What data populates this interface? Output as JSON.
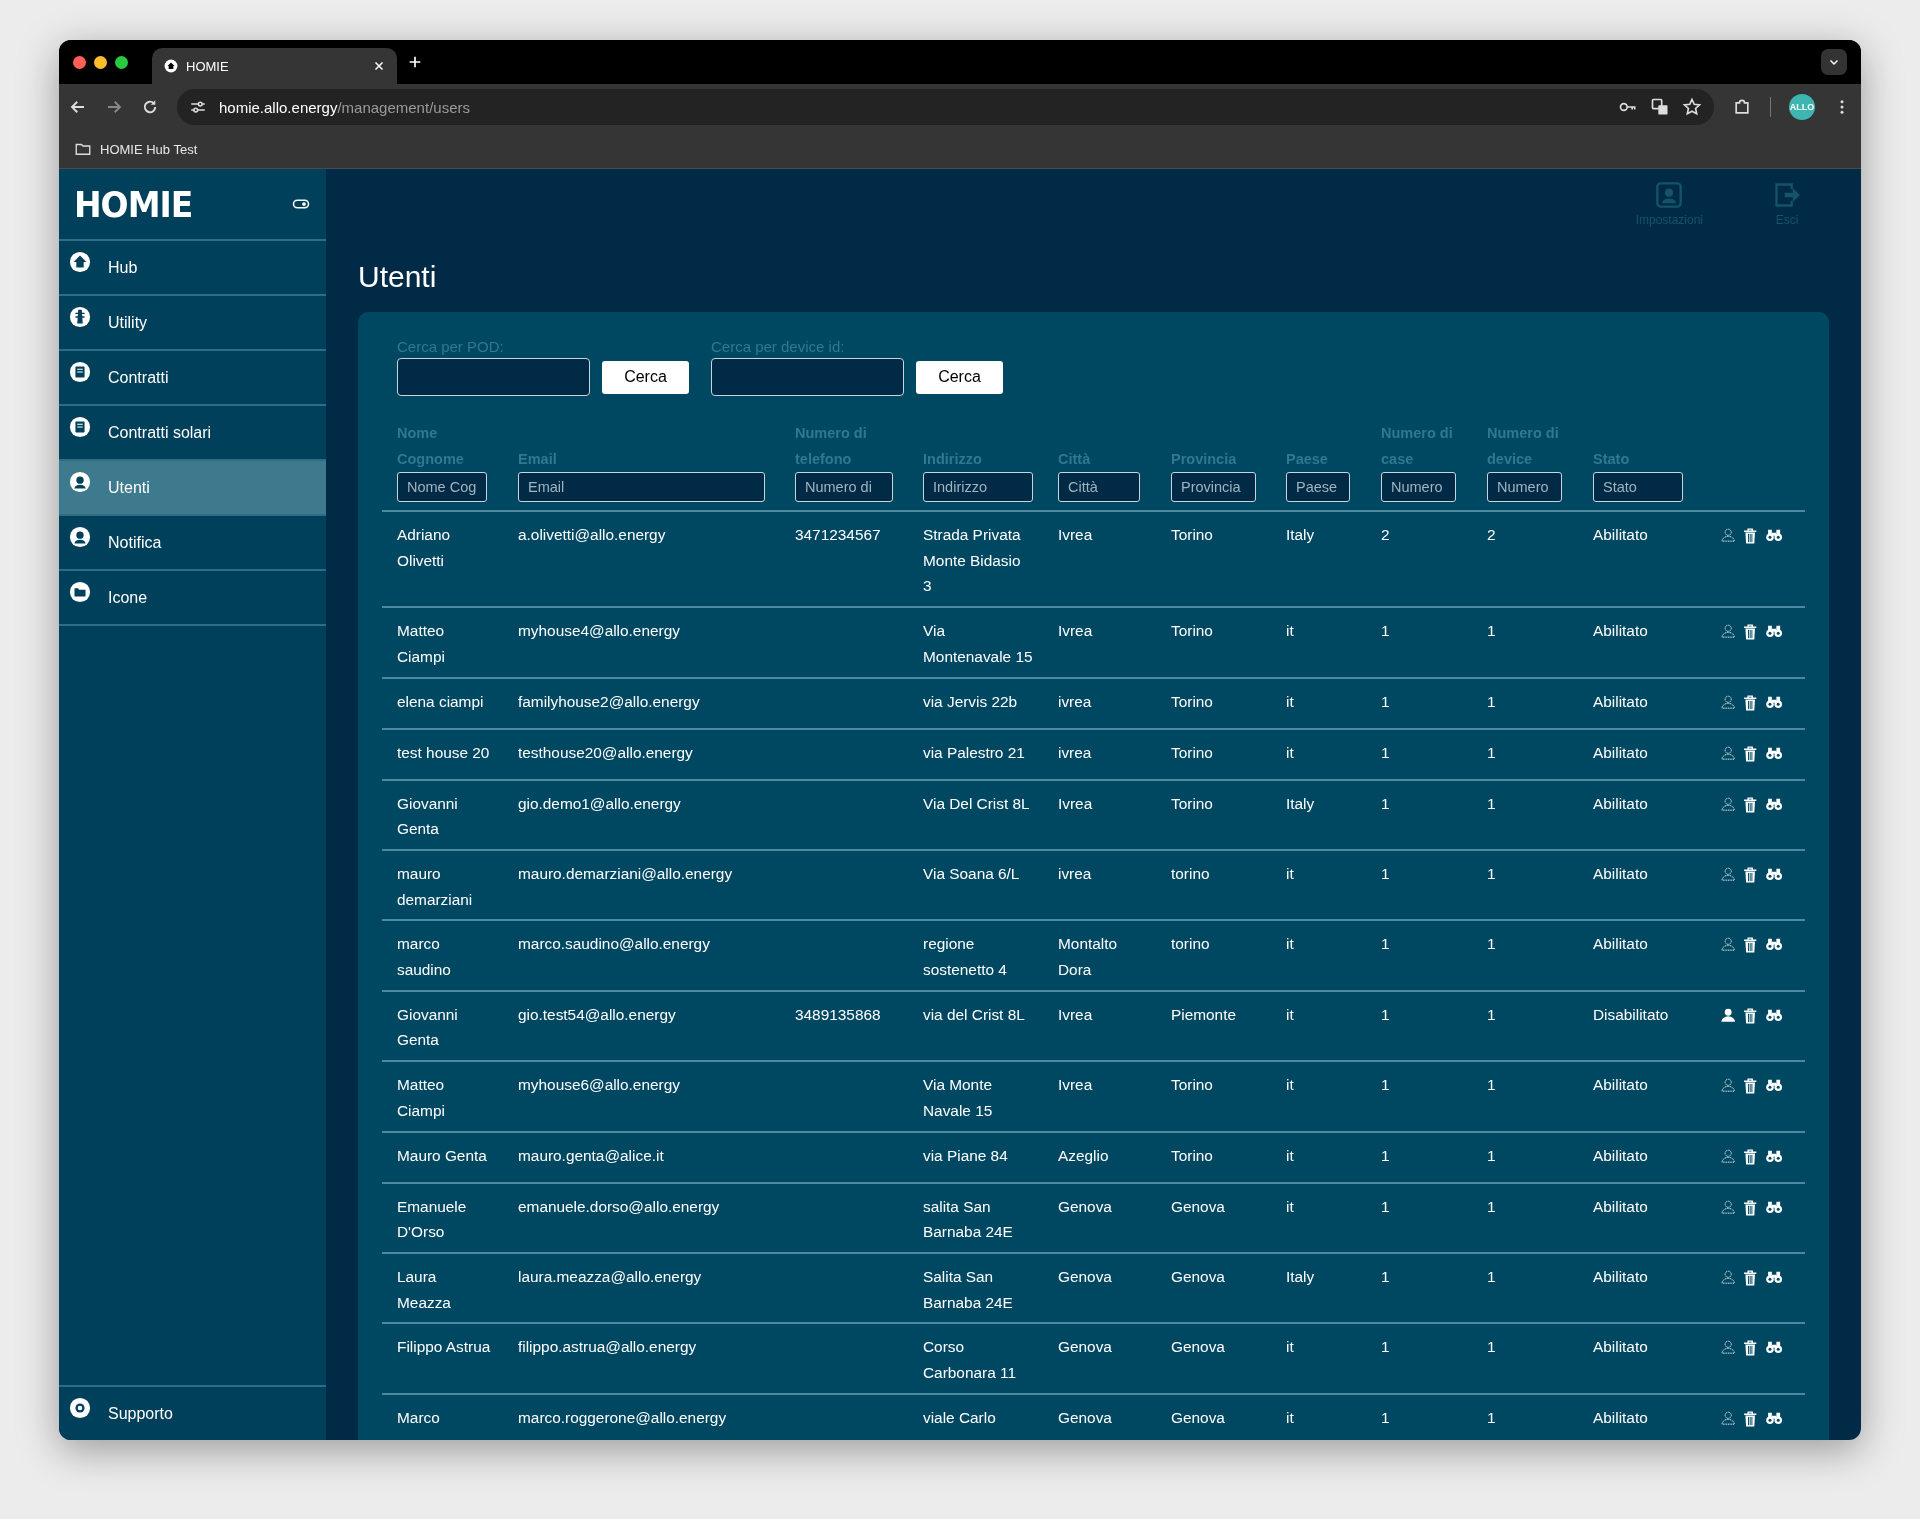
{
  "browser": {
    "tab_title": "HOMIE",
    "url_host": "homie.allo.energy",
    "url_path": "/management/users",
    "bookmark": "HOMIE Hub Test",
    "profile": "ALLO"
  },
  "sidebar": {
    "logo": "HOMIE",
    "items": [
      {
        "label": "Hub",
        "kind": "home",
        "selected": false
      },
      {
        "label": "Utility",
        "kind": "tower",
        "selected": false
      },
      {
        "label": "Contratti",
        "kind": "contract",
        "selected": false
      },
      {
        "label": "Contratti solari",
        "kind": "contract",
        "selected": false
      },
      {
        "label": "Utenti",
        "kind": "user",
        "selected": true
      },
      {
        "label": "Notifica",
        "kind": "user",
        "selected": false
      },
      {
        "label": "Icone",
        "kind": "folder",
        "selected": false
      }
    ],
    "support": "Supporto"
  },
  "header_actions": [
    {
      "label": "Impostazioni",
      "kind": "person"
    },
    {
      "label": "Esci",
      "kind": "exit"
    }
  ],
  "page_title": "Utenti",
  "searches": [
    {
      "label": "Cerca per POD:",
      "button": "Cerca"
    },
    {
      "label": "Cerca per device id:",
      "button": "Cerca"
    }
  ],
  "table": {
    "columns": [
      {
        "label": "Nome Cognome",
        "placeholder": "Nome Cog"
      },
      {
        "label": "Email",
        "placeholder": "Email"
      },
      {
        "label": "Numero di telefono",
        "placeholder": "Numero di"
      },
      {
        "label": "Indirizzo",
        "placeholder": "Indirizzo"
      },
      {
        "label": "Città",
        "placeholder": "Città"
      },
      {
        "label": "Provincia",
        "placeholder": "Provincia"
      },
      {
        "label": "Paese",
        "placeholder": "Paese"
      },
      {
        "label": "Numero di case",
        "placeholder": "Numero"
      },
      {
        "label": "Numero di device",
        "placeholder": "Numero"
      },
      {
        "label": "Stato",
        "placeholder": "Stato"
      }
    ],
    "rows": [
      {
        "cells": [
          "Adriano Olivetti",
          "a.olivetti@allo.energy",
          "3471234567",
          "Strada Privata Monte Bidasio 3",
          "Ivrea",
          "Torino",
          "Italy",
          "2",
          "2",
          "Abilitato"
        ],
        "enabled": true
      },
      {
        "cells": [
          "Matteo Ciampi",
          "myhouse4@allo.energy",
          "",
          "Via Montenavale 15",
          "Ivrea",
          "Torino",
          "it",
          "1",
          "1",
          "Abilitato"
        ],
        "enabled": true
      },
      {
        "cells": [
          "elena ciampi",
          "familyhouse2@allo.energy",
          "",
          "via Jervis 22b",
          "ivrea",
          "Torino",
          "it",
          "1",
          "1",
          "Abilitato"
        ],
        "enabled": true
      },
      {
        "cells": [
          "test house 20",
          "testhouse20@allo.energy",
          "",
          "via Palestro 21",
          "ivrea",
          "Torino",
          "it",
          "1",
          "1",
          "Abilitato"
        ],
        "enabled": true
      },
      {
        "cells": [
          "Giovanni Genta",
          "gio.demo1@allo.energy",
          "",
          "Via Del Crist 8L",
          "Ivrea",
          "Torino",
          "Italy",
          "1",
          "1",
          "Abilitato"
        ],
        "enabled": true
      },
      {
        "cells": [
          "mauro demarziani",
          "mauro.demarziani@allo.energy",
          "",
          "Via Soana 6/L",
          "ivrea",
          "torino",
          "it",
          "1",
          "1",
          "Abilitato"
        ],
        "enabled": true
      },
      {
        "cells": [
          "marco saudino",
          "marco.saudino@allo.energy",
          "",
          "regione sostenetto 4",
          "Montalto Dora",
          "torino",
          "it",
          "1",
          "1",
          "Abilitato"
        ],
        "enabled": true
      },
      {
        "cells": [
          "Giovanni Genta",
          "gio.test54@allo.energy",
          "3489135868",
          "via del Crist 8L",
          "Ivrea",
          "Piemonte",
          "it",
          "1",
          "1",
          "Disabilitato"
        ],
        "enabled": false
      },
      {
        "cells": [
          "Matteo Ciampi",
          "myhouse6@allo.energy",
          "",
          "Via Monte Navale 15",
          "Ivrea",
          "Torino",
          "it",
          "1",
          "1",
          "Abilitato"
        ],
        "enabled": true
      },
      {
        "cells": [
          "Mauro Genta",
          "mauro.genta@alice.it",
          "",
          "via Piane 84",
          "Azeglio",
          "Torino",
          "it",
          "1",
          "1",
          "Abilitato"
        ],
        "enabled": true
      },
      {
        "cells": [
          "Emanuele D'Orso",
          "emanuele.dorso@allo.energy",
          "",
          "salita San Barnaba 24E",
          "Genova",
          "Genova",
          "it",
          "1",
          "1",
          "Abilitato"
        ],
        "enabled": true
      },
      {
        "cells": [
          "Laura Meazza",
          "laura.meazza@allo.energy",
          "",
          "Salita San Barnaba 24E",
          "Genova",
          "Genova",
          "Italy",
          "1",
          "1",
          "Abilitato"
        ],
        "enabled": true
      },
      {
        "cells": [
          "Filippo Astrua",
          "filippo.astrua@allo.energy",
          "",
          "Corso Carbonara 11",
          "Genova",
          "Genova",
          "it",
          "1",
          "1",
          "Abilitato"
        ],
        "enabled": true
      },
      {
        "cells": [
          "Marco",
          "marco.roggerone@allo.energy",
          "",
          "viale Carlo",
          "Genova",
          "Genova",
          "it",
          "1",
          "1",
          "Abilitato"
        ],
        "enabled": true
      }
    ]
  }
}
